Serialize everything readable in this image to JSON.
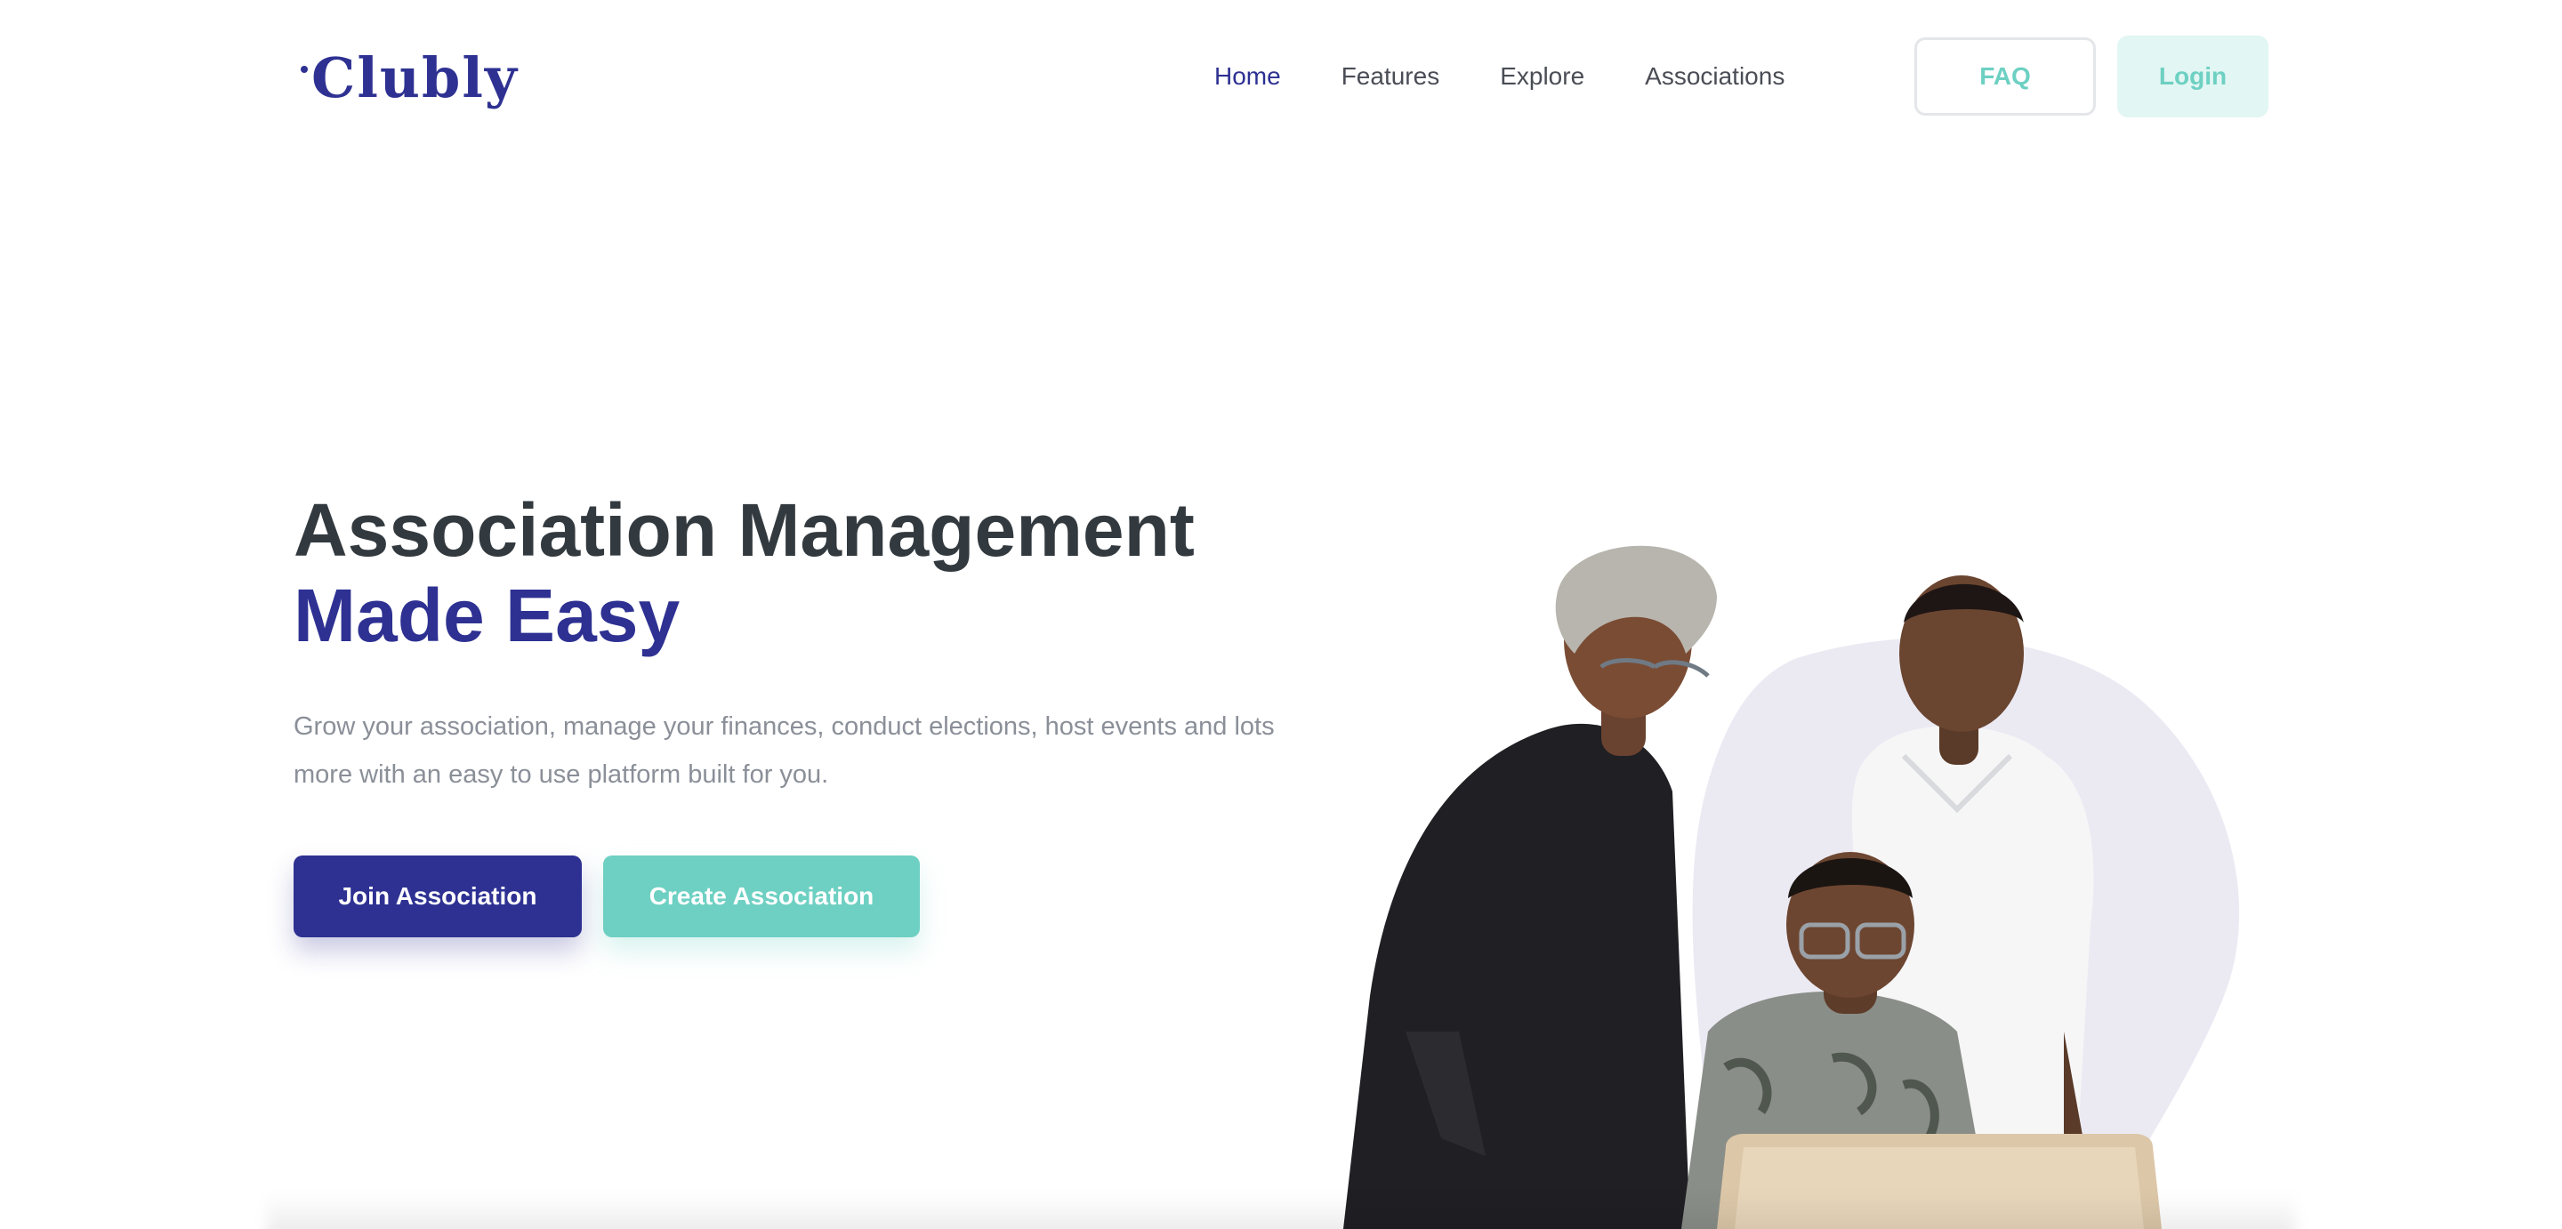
{
  "header": {
    "logo": "Clubly",
    "nav": [
      {
        "label": "Home",
        "active": true
      },
      {
        "label": "Features",
        "active": false
      },
      {
        "label": "Explore",
        "active": false
      },
      {
        "label": "Associations",
        "active": false
      }
    ],
    "faq_label": "FAQ",
    "login_label": "Login"
  },
  "hero": {
    "title_line1": "Association Management",
    "title_line2": "Made Easy",
    "subtitle": "Grow your association, manage your finances, conduct elections, host events and lots more with an easy to use platform built for you.",
    "join_label": "Join Association",
    "create_label": "Create Association"
  },
  "colors": {
    "brand": "#2e3192",
    "accent": "#6dd0c2",
    "accent_light": "#e2f6f3",
    "heading": "#333a3f",
    "muted": "#8a8f98",
    "blob": "#ebeaf3"
  }
}
